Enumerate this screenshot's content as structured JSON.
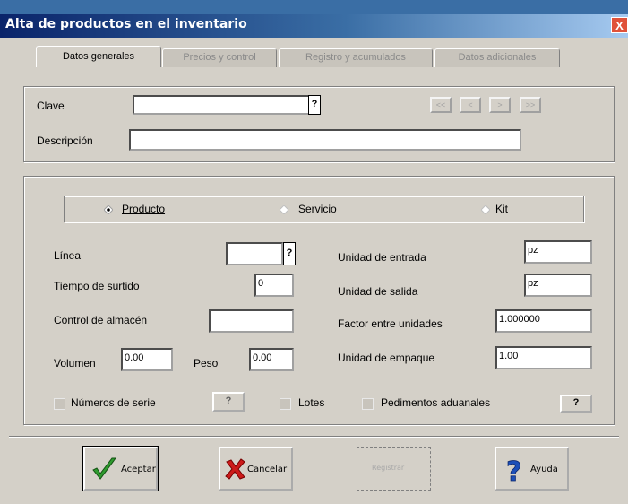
{
  "window": {
    "title": "Alta de productos en el inventario",
    "close_label": "X"
  },
  "tabs": [
    {
      "label": "Datos generales",
      "active": true
    },
    {
      "label": "Precios y control",
      "active": false
    },
    {
      "label": "Registro y acumulados",
      "active": false
    },
    {
      "label": "Datos adicionales",
      "active": false
    }
  ],
  "header": {
    "clave_label": "Clave",
    "clave_value": "",
    "descripcion_label": "Descripción",
    "descripcion_value": "",
    "lookup_label": "?",
    "nav": {
      "first": "<<",
      "prev": "<",
      "next": ">",
      "last": ">>"
    }
  },
  "type_selector": {
    "options": [
      {
        "label": "Producto",
        "selected": true
      },
      {
        "label": "Servicio",
        "selected": false
      },
      {
        "label": "Kit",
        "selected": false
      }
    ]
  },
  "fields": {
    "linea_label": "Línea",
    "linea_value": "",
    "lookup_label": "?",
    "tiempo_label": "Tiempo de surtido",
    "tiempo_value": "0",
    "control_label": "Control de almacén",
    "control_value": "",
    "volumen_label": "Volumen",
    "volumen_value": "0.00",
    "peso_label": "Peso",
    "peso_value": "0.00",
    "unidad_entrada_label": "Unidad de entrada",
    "unidad_entrada_value": "pz",
    "unidad_salida_label": "Unidad de salida",
    "unidad_salida_value": "pz",
    "factor_label": "Factor entre unidades",
    "factor_value": "1.000000",
    "empaque_label": "Unidad de empaque",
    "empaque_value": "1.00"
  },
  "checks": {
    "series_label": "Números de serie",
    "series_q": "?",
    "lotes_label": "Lotes",
    "pedimentos_label": "Pedimentos aduanales",
    "pedimentos_q": "?"
  },
  "buttons": {
    "aceptar": "Aceptar",
    "cancelar": "Cancelar",
    "disabled": "Registrar",
    "ayuda": "Ayuda"
  },
  "colors": {
    "titlebar": "#0a246a",
    "face": "#d4d0c8",
    "accept": "#2e9a2e",
    "cancel": "#cc1a1a",
    "help": "#1d4fb8"
  }
}
